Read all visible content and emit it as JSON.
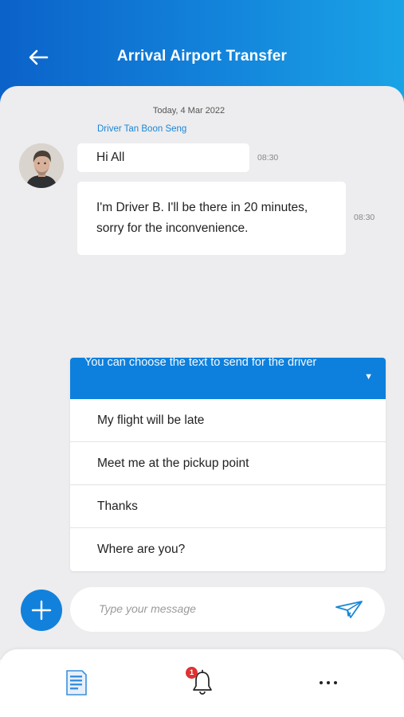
{
  "header": {
    "title": "Arrival Airport Transfer",
    "back_icon": "arrow-left-icon"
  },
  "chat": {
    "date": "Today, 4 Mar 2022",
    "sender": "Driver Tan Boon Seng",
    "messages": [
      {
        "text": "Hi All",
        "time": "08:30"
      },
      {
        "text": "I'm Driver B. I'll be there in 20 minutes, sorry for the inconvenience.",
        "time": "08:30"
      }
    ]
  },
  "quick_replies": {
    "header": "You can choose the text to send for the driver",
    "caret_icon": "caret-down-icon",
    "options": [
      "My flight will be late",
      "Meet me at the pickup point",
      "Thanks",
      "Where are you?"
    ]
  },
  "composer": {
    "placeholder": "Type your message",
    "add_icon": "plus-icon",
    "send_icon": "paper-plane-icon"
  },
  "bottom_nav": {
    "notification_count": "1",
    "items": [
      "document-icon",
      "bell-icon",
      "more-icon"
    ]
  },
  "colors": {
    "primary": "#0d80dd",
    "header_start": "#0b62c9",
    "header_end": "#1aa3e6",
    "sender_name": "#1a86d6",
    "badge": "#e03131"
  }
}
